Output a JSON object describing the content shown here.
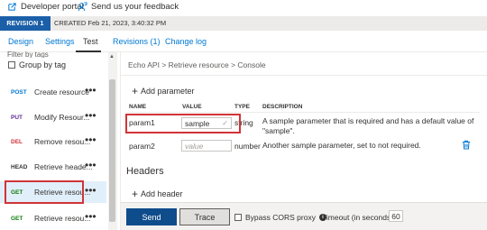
{
  "top": {
    "developer_portal": "Developer portal",
    "feedback": "Send us your feedback"
  },
  "revision": {
    "badge": "REVISION 1",
    "created": "CREATED Feb 21, 2023, 3:40:32 PM"
  },
  "tabs": [
    {
      "label": "Design"
    },
    {
      "label": "Settings"
    },
    {
      "label": "Test"
    },
    {
      "label": "Revisions (1)"
    },
    {
      "label": "Change log"
    }
  ],
  "left": {
    "filter_placeholder": "Filter by tags",
    "group_by_tag": "Group by tag",
    "operations": [
      {
        "verb": "POST",
        "name": "Create resource",
        "color": "#0078d4"
      },
      {
        "verb": "PUT",
        "name": "Modify Resour...",
        "color": "#5c2d91"
      },
      {
        "verb": "DEL",
        "name": "Remove resou...",
        "color": "#d13438"
      },
      {
        "verb": "HEAD",
        "name": "Retrieve heade...",
        "color": "#323130"
      },
      {
        "verb": "GET",
        "name": "Retrieve resou...",
        "color": "#107c10"
      },
      {
        "verb": "GET",
        "name": "Retrieve resou...",
        "color": "#107c10"
      }
    ],
    "more": "•••"
  },
  "main": {
    "breadcrumb": "Echo API  >  Retrieve resource  >  Console",
    "add_parameter": "Add parameter",
    "columns": {
      "name": "NAME",
      "value": "VALUE",
      "type": "TYPE",
      "description": "DESCRIPTION"
    },
    "params": [
      {
        "name": "param1",
        "value": "sample",
        "type": "string",
        "description": "A sample parameter that is required and has a default value of \"sample\"."
      },
      {
        "name": "param2",
        "value_placeholder": "value",
        "type": "number",
        "description": "Another sample parameter, set to not required."
      }
    ],
    "headers_title": "Headers",
    "add_header": "Add header",
    "send": "Send",
    "trace": "Trace",
    "bypass_cors": "Bypass CORS proxy",
    "timeout_label": "Timeout (in seconds)",
    "timeout_value": "60"
  }
}
